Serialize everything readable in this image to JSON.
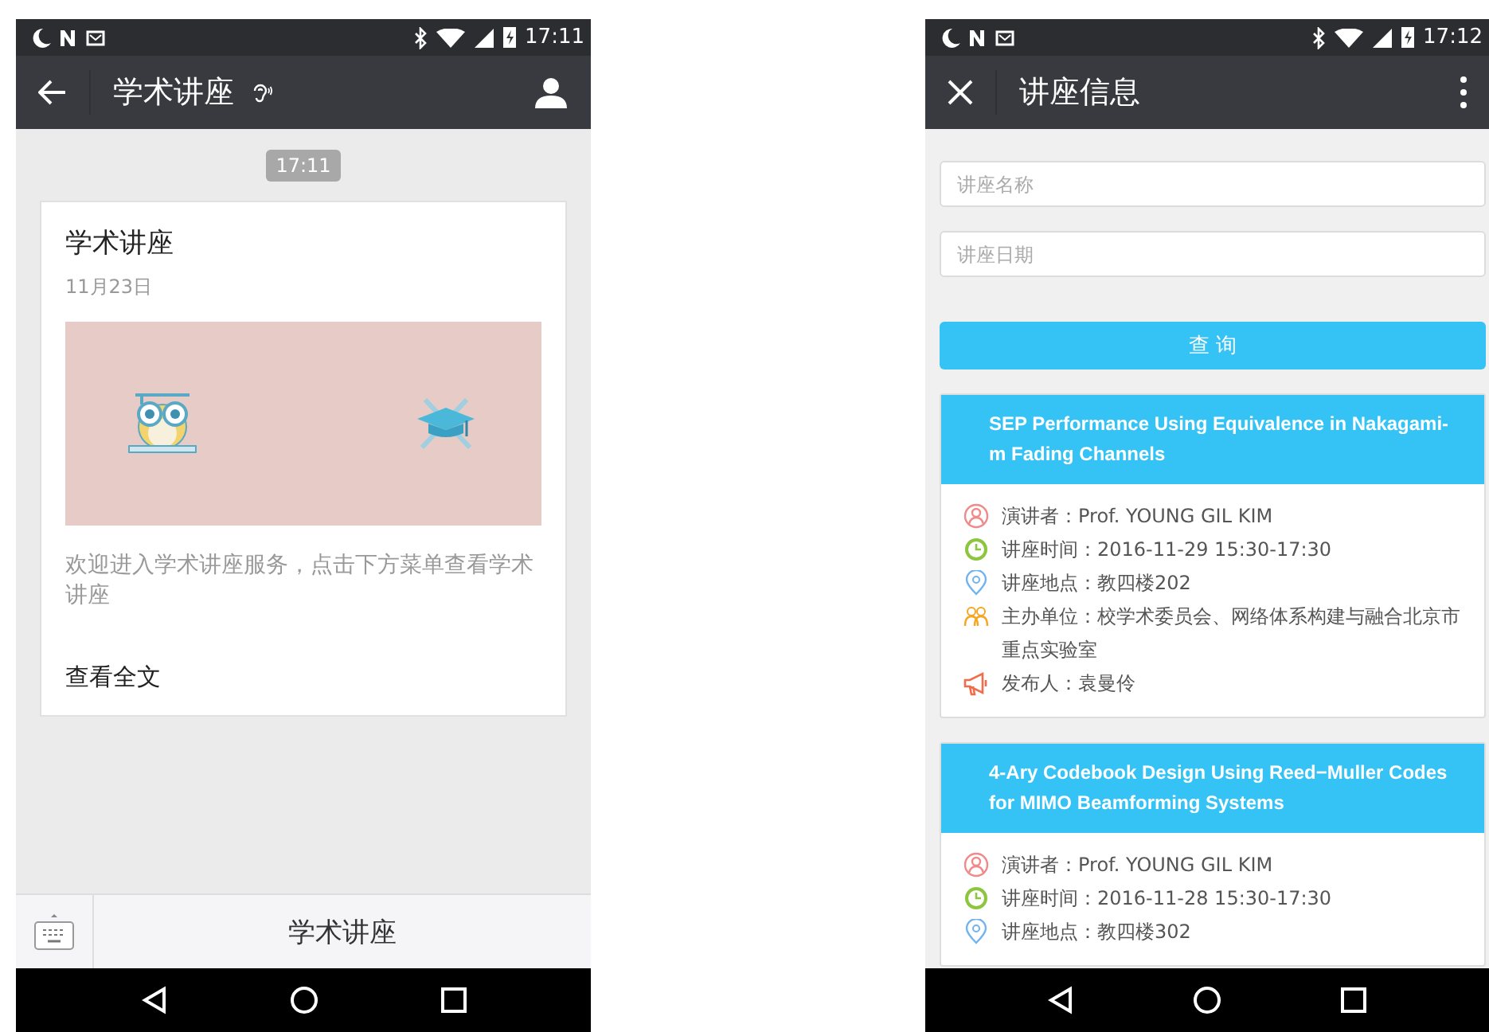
{
  "left_screen": {
    "status_bar": {
      "time": "17:11"
    },
    "header": {
      "title": "学术讲座"
    },
    "timestamp": "17:11",
    "article": {
      "title": "学术讲座",
      "date": "11月23日",
      "summary": "欢迎进入学术讲座服务，点击下方菜单查看学术讲座",
      "link": "查看全文"
    },
    "bottom_menu": {
      "items": [
        "学术讲座"
      ]
    }
  },
  "right_screen": {
    "status_bar": {
      "time": "17:12"
    },
    "header": {
      "title": "讲座信息"
    },
    "search_form": {
      "fields": [
        {
          "placeholder": "讲座名称"
        },
        {
          "placeholder": "讲座日期"
        }
      ],
      "button": "查 询"
    },
    "lectures": [
      {
        "title": "SEP Performance Using Equivalence in Nakagami-m Fading Channels",
        "details": [
          {
            "kind": "speaker",
            "text": "演讲者：Prof. YOUNG GIL KIM"
          },
          {
            "kind": "time",
            "text": "讲座时间：2016-11-29  15:30-17:30"
          },
          {
            "kind": "place",
            "text": "讲座地点：教四楼202"
          },
          {
            "kind": "organizer",
            "text": "主办单位：校学术委员会、网络体系构建与融合北京市重点实验室"
          },
          {
            "kind": "publisher",
            "text": "发布人：袁曼伶"
          }
        ]
      },
      {
        "title": "4-Ary Codebook Design Using Reed−Muller Codes for MIMO Beamforming Systems",
        "details": [
          {
            "kind": "speaker",
            "text": "演讲者：Prof. YOUNG GIL KIM"
          },
          {
            "kind": "time",
            "text": "讲座时间：2016-11-28  15:30-17:30"
          },
          {
            "kind": "place",
            "text": "讲座地点：教四楼302"
          }
        ]
      }
    ]
  }
}
